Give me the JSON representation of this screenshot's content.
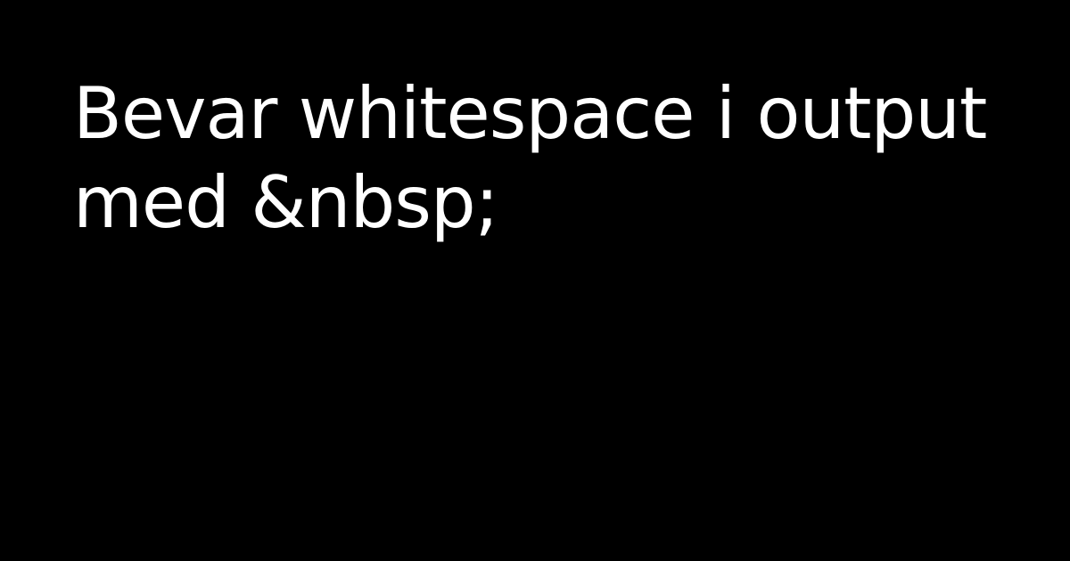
{
  "card": {
    "title": "Bevar whitespace i output med &nbsp;"
  },
  "colors": {
    "background": "#000000",
    "text": "#ffffff"
  }
}
